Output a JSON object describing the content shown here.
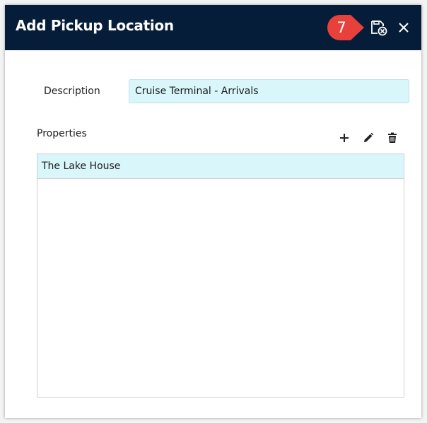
{
  "dialog": {
    "title": "Add Pickup Location",
    "step_badge": "7",
    "icons": {
      "save_cancel": "save-cancel-icon",
      "close": "close-icon"
    }
  },
  "form": {
    "description_label": "Description",
    "description_value": "Cruise Terminal - Arrivals",
    "properties_label": "Properties"
  },
  "toolbar": {
    "add": "plus-icon",
    "edit": "pencil-icon",
    "delete": "trash-icon"
  },
  "properties": {
    "items": [
      "The Lake House"
    ]
  },
  "colors": {
    "header_bg": "#061d39",
    "badge": "#e8403b",
    "selected_row": "#d9f6fb"
  }
}
